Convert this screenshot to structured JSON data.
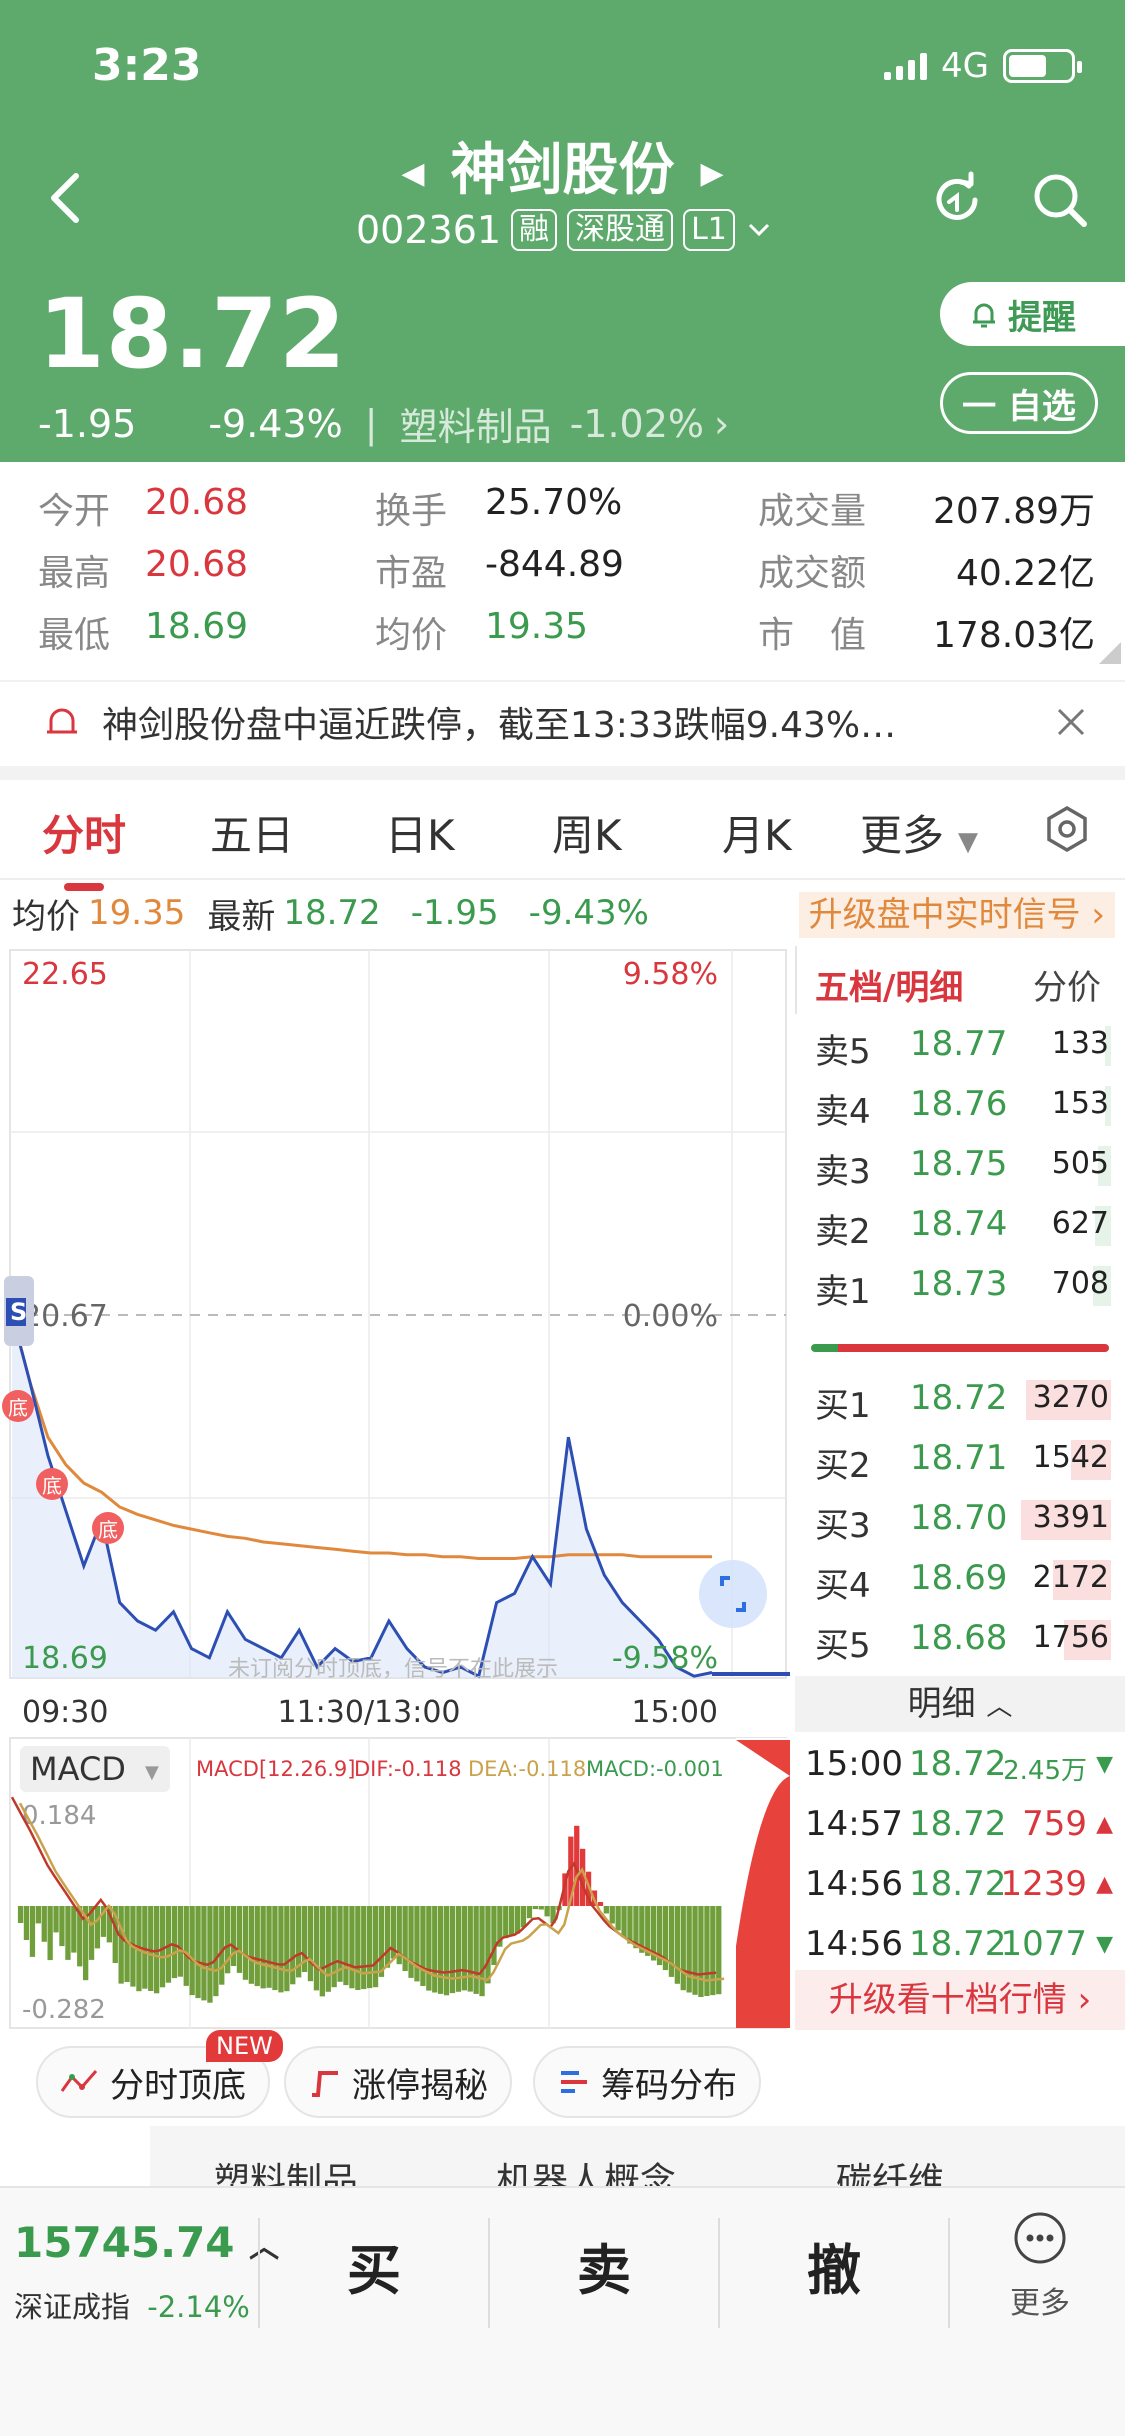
{
  "status_bar": {
    "time": "3:23",
    "network": "4G"
  },
  "header": {
    "stock_name": "神剑股份",
    "stock_code": "002361",
    "tags": [
      "融",
      "深股通",
      "L1"
    ],
    "price": "18.72",
    "change": "-1.95",
    "change_pct": "-9.43%",
    "sector": "塑料制品",
    "sector_pct": "-1.02%",
    "remind_label": "提醒",
    "fav_label": "一 自选"
  },
  "stats": {
    "open_label": "今开",
    "open": "20.68",
    "high_label": "最高",
    "high": "20.68",
    "low_label": "最低",
    "low": "18.69",
    "turnover_label": "换手",
    "turnover": "25.70%",
    "pe_label": "市盈",
    "pe": "-844.89",
    "avg_label": "均价",
    "avg": "19.35",
    "volume_label": "成交量",
    "volume": "207.89万",
    "amount_label": "成交额",
    "amount": "40.22亿",
    "mcap_label": "市　值",
    "mcap": "178.03亿"
  },
  "alert": {
    "text": "神剑股份盘中逼近跌停，截至13:33跌幅9.43%…"
  },
  "tabs": [
    "分时",
    "五日",
    "日K",
    "周K",
    "月K",
    "更多"
  ],
  "infobar": {
    "avg_label": "均价",
    "avg": "19.35",
    "last_label": "最新",
    "last": "18.72",
    "chg": "-1.95",
    "chg_pct": "-9.43%",
    "upgrade": "升级盘中实时信号"
  },
  "chart": {
    "y_top": "22.65",
    "pct_top": "9.58%",
    "y_mid": "20.67",
    "pct_mid": "0.00%",
    "y_bot": "18.69",
    "pct_bot": "-9.58%",
    "x_labels": [
      "09:30",
      "11:30/13:00",
      "15:00"
    ],
    "watermark": "未订阅分时顶底，信号不在此展示",
    "bottom_marker": "底",
    "s_marker": "S",
    "macd_label": "MACD",
    "macd_params": "MACD[12.26.9]",
    "dif": "DIF:-0.118",
    "dea": "DEA:-0.118",
    "macd": "MACD:-0.001",
    "macd_top": "0.184",
    "macd_bot": "-0.282"
  },
  "chart_data": {
    "type": "line",
    "series": [
      {
        "values": [
          20.67,
          20.3,
          19.9,
          19.6,
          19.3,
          19.55,
          19.1,
          19.0,
          18.95,
          19.05,
          18.85,
          18.8,
          19.05,
          18.9,
          18.85,
          18.8,
          18.95,
          18.75,
          18.85,
          18.78,
          18.8,
          19.0,
          18.85,
          18.75,
          18.72,
          18.75,
          18.7,
          19.1,
          19.15,
          19.35,
          19.2,
          20.0,
          19.5,
          19.25,
          19.1,
          19.0,
          18.9,
          18.75,
          18.7,
          18.72
        ]
      },
      {
        "values": [
          20.67,
          20.3,
          20.0,
          19.85,
          19.75,
          19.7,
          19.62,
          19.58,
          19.55,
          19.52,
          19.5,
          19.48,
          19.46,
          19.45,
          19.43,
          19.42,
          19.41,
          19.4,
          19.39,
          19.38,
          19.37,
          19.37,
          19.36,
          19.36,
          19.35,
          19.35,
          19.34,
          19.34,
          19.34,
          19.35,
          19.35,
          19.36,
          19.36,
          19.36,
          19.36,
          19.35,
          19.35,
          19.35,
          19.35,
          19.35
        ]
      }
    ],
    "ylim": [
      18.69,
      22.65
    ]
  },
  "orderbook": {
    "title": "五档/明细",
    "alt": "分价",
    "asks": [
      {
        "k": "卖5",
        "p": "18.77",
        "v": "133",
        "f": 0.04
      },
      {
        "k": "卖4",
        "p": "18.76",
        "v": "153",
        "f": 0.05
      },
      {
        "k": "卖3",
        "p": "18.75",
        "v": "505",
        "f": 0.15
      },
      {
        "k": "卖2",
        "p": "18.74",
        "v": "627",
        "f": 0.18
      },
      {
        "k": "卖1",
        "p": "18.73",
        "v": "708",
        "f": 0.2
      }
    ],
    "bids": [
      {
        "k": "买1",
        "p": "18.72",
        "v": "3270",
        "f": 0.95
      },
      {
        "k": "买2",
        "p": "18.71",
        "v": "1542",
        "f": 0.45
      },
      {
        "k": "买3",
        "p": "18.70",
        "v": "3391",
        "f": 1.0
      },
      {
        "k": "买4",
        "p": "18.69",
        "v": "2172",
        "f": 0.64
      },
      {
        "k": "买5",
        "p": "18.68",
        "v": "1756",
        "f": 0.52
      }
    ],
    "detail_label": "明细",
    "ticks": [
      {
        "t": "15:00",
        "p": "18.72",
        "v": "2.45万",
        "dir": "down"
      },
      {
        "t": "14:57",
        "p": "18.72",
        "v": "759",
        "dir": "up"
      },
      {
        "t": "14:56",
        "p": "18.72",
        "v": "1239",
        "dir": "up"
      },
      {
        "t": "14:56",
        "p": "18.72",
        "v": "1077",
        "dir": "down"
      }
    ],
    "upgrade": "升级看十档行情"
  },
  "quicktools": [
    "分时顶底",
    "涨停揭秘",
    "筹码分布"
  ],
  "new_badge": "NEW",
  "peek_texts": [
    "塑料制品",
    "机器人概念",
    "碳纤维"
  ],
  "bottombar": {
    "index_value": "15745.74",
    "index_name": "深证成指",
    "index_pct": "-2.14%",
    "buy": "买",
    "sell": "卖",
    "cancel": "撤",
    "more": "更多"
  }
}
